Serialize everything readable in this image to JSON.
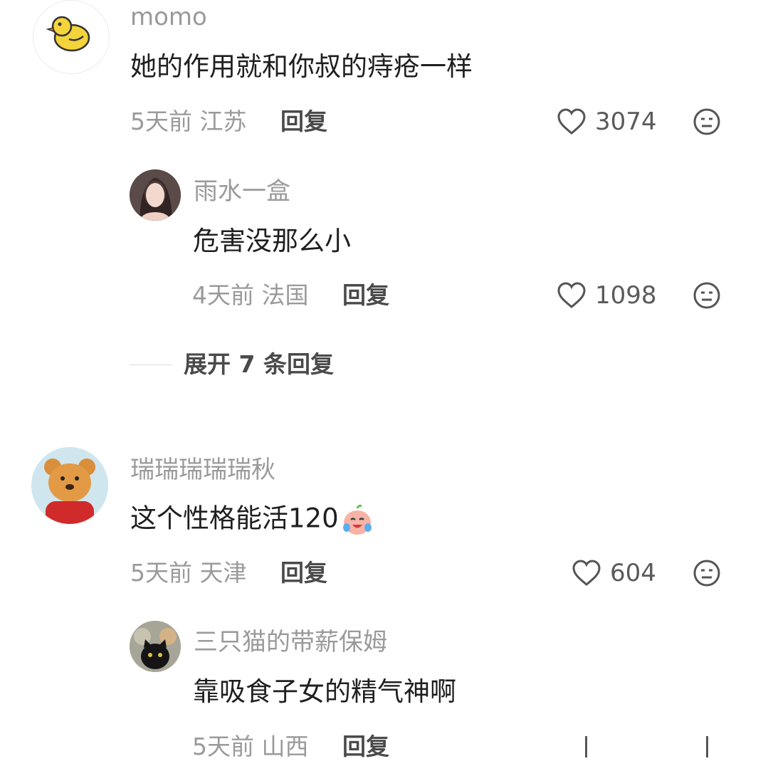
{
  "comments": [
    {
      "user": "momo",
      "text": "她的作用就和你叔的痔疮一样",
      "time": "5天前",
      "location": "江苏",
      "reply_label": "回复",
      "likes": "3074",
      "avatar_icon": "duck-avatar"
    },
    {
      "user": "雨水一盒",
      "text": "危害没那么小",
      "time": "4天前",
      "location": "法国",
      "reply_label": "回复",
      "likes": "1098",
      "avatar_icon": "photo-avatar"
    },
    {
      "user": "瑞瑞瑞瑞瑞秋",
      "text": "这个性格能活120",
      "time": "5天前",
      "location": "天津",
      "reply_label": "回复",
      "likes": "604",
      "avatar_icon": "bear-avatar",
      "emoji_icon": "crying-laughing-emoji"
    },
    {
      "user": "三只猫的带薪保姆",
      "text": "靠吸食子女的精气神啊",
      "time": "5天前",
      "location": "山西",
      "reply_label": "回复",
      "avatar_icon": "cats-avatar"
    }
  ],
  "expand_replies": "展开 7 条回复",
  "colors": {
    "text": "#1f1f1f",
    "secondary": "#9a9a9a",
    "reply": "#4a4a4a"
  }
}
